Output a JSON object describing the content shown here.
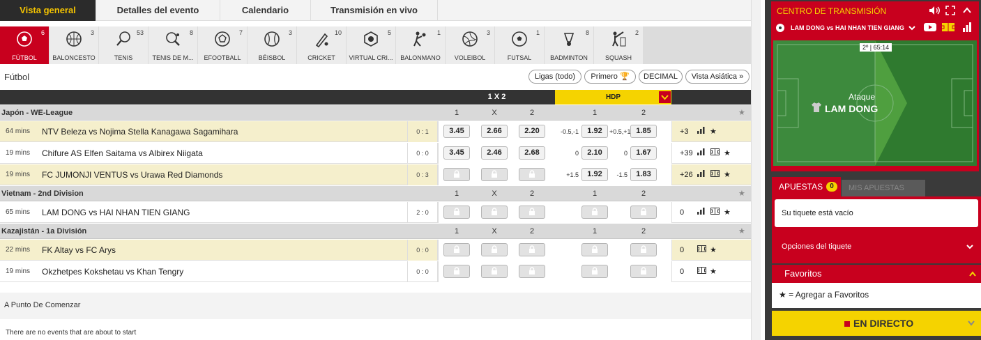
{
  "tabs": [
    {
      "label": "Vista general",
      "active": true
    },
    {
      "label": "Detalles del evento"
    },
    {
      "label": "Calendario"
    },
    {
      "label": "Transmisión en vivo"
    }
  ],
  "sports": [
    {
      "label": "FÚTBOL",
      "count": "6",
      "icon": "soccer-ball-icon",
      "active": true
    },
    {
      "label": "BALONCESTO",
      "count": "3",
      "icon": "basketball-icon"
    },
    {
      "label": "TENIS",
      "count": "53",
      "icon": "tennis-racket-icon"
    },
    {
      "label": "TENIS DE M...",
      "count": "8",
      "icon": "table-tennis-icon"
    },
    {
      "label": "EFOOTBALL",
      "count": "7",
      "icon": "efootball-icon"
    },
    {
      "label": "BÉISBOL",
      "count": "3",
      "icon": "baseball-icon"
    },
    {
      "label": "CRICKET",
      "count": "10",
      "icon": "cricket-icon"
    },
    {
      "label": "VIRTUAL CRI...",
      "count": "5",
      "icon": "virtual-cricket-icon"
    },
    {
      "label": "BALONMANO",
      "count": "1",
      "icon": "handball-icon"
    },
    {
      "label": "VOLEIBOL",
      "count": "3",
      "icon": "volleyball-icon"
    },
    {
      "label": "FUTSAL",
      "count": "1",
      "icon": "futsal-icon"
    },
    {
      "label": "BADMINTON",
      "count": "8",
      "icon": "shuttlecock-icon"
    },
    {
      "label": "SQUASH",
      "count": "2",
      "icon": "squash-icon"
    }
  ],
  "toolbar": {
    "section_title": "Fútbol",
    "leagues_btn": "Ligas (todo)",
    "first_btn": "Primero",
    "odds_btn": "DECIMAL",
    "view_btn": "Vista Asiática"
  },
  "header": {
    "x12": "1 X 2",
    "hdp": "HDP"
  },
  "col_labels": {
    "one": "1",
    "x": "X",
    "two": "2",
    "h1": "1",
    "h2": "2"
  },
  "leagues": [
    {
      "name": "Japón - WE-League",
      "rows": [
        {
          "time": "64 mins",
          "event": "NTV Beleza vs Nojima Stella Kanagawa Sagamihara",
          "score": "0 : 1",
          "o1": "3.45",
          "ox": "2.66",
          "o2": "2.20",
          "h1v": "-0.5,-1",
          "h1": "1.92",
          "h2v": "+0.5,+1",
          "h2": "1.85",
          "more": "+3",
          "hl": true,
          "icons": [
            "stats-icon",
            "star-icon"
          ]
        },
        {
          "time": "19 mins",
          "event": "Chifure AS Elfen Saitama vs Albirex Niigata",
          "score": "0 : 0",
          "o1": "3.45",
          "ox": "2.46",
          "o2": "2.68",
          "h1v": "0",
          "h1": "2.10",
          "h2v": "0",
          "h2": "1.67",
          "more": "+39",
          "hl": false,
          "icons": [
            "stats-icon",
            "pitch-icon",
            "star-icon"
          ]
        },
        {
          "time": "19 mins",
          "event": "FC JUMONJI VENTUS vs Urawa Red Diamonds",
          "score": "0 : 3",
          "lock": true,
          "h1v": "+1.5",
          "h1": "1.92",
          "h2v": "-1.5",
          "h2": "1.83",
          "more": "+26",
          "hl": true,
          "icons": [
            "stats-icon",
            "pitch-icon",
            "star-icon"
          ]
        }
      ]
    },
    {
      "name": "Vietnam - 2nd Division",
      "rows": [
        {
          "time": "65 mins",
          "event": "LAM DONG vs HAI NHAN TIEN GIANG",
          "score": "2 : 0",
          "lock": true,
          "lockh": true,
          "more": "0",
          "hl": false,
          "icons": [
            "stats-icon",
            "pitch-icon",
            "star-icon"
          ]
        }
      ]
    },
    {
      "name": "Kazajistán - 1a División",
      "rows": [
        {
          "time": "22 mins",
          "event": "FK Altay vs FC Arys",
          "score": "0 : 0",
          "lock": true,
          "lockh": true,
          "more": "0",
          "hl": true,
          "icons": [
            "pitch-icon",
            "star-icon"
          ]
        },
        {
          "time": "19 mins",
          "event": "Okzhetpes Kokshetau vs Khan Tengry",
          "score": "0 : 0",
          "lock": true,
          "lockh": true,
          "more": "0",
          "hl": false,
          "icons": [
            "pitch-icon",
            "star-icon"
          ]
        }
      ]
    }
  ],
  "upcoming": {
    "title": "A Punto De Comenzar",
    "empty": "There are no events that are about to start"
  },
  "stream": {
    "title": "CENTRO DE TRANSMISIÓN",
    "match": "LAM DONG vs HAI NHAN TIEN GIANG",
    "timer": "2º | 65:14",
    "attack_label": "Ataque",
    "attack_team": "LAM DONG"
  },
  "bets": {
    "tab_label": "APUESTAS",
    "count": "0",
    "my_bets": "MIS APUESTAS",
    "empty": "Su tiquete está vacío",
    "options": "Opciones del tiquete"
  },
  "favorites": {
    "title": "Favoritos",
    "hint": "= Agregar a Favoritos"
  },
  "live": {
    "label": "EN DIRECTO"
  }
}
